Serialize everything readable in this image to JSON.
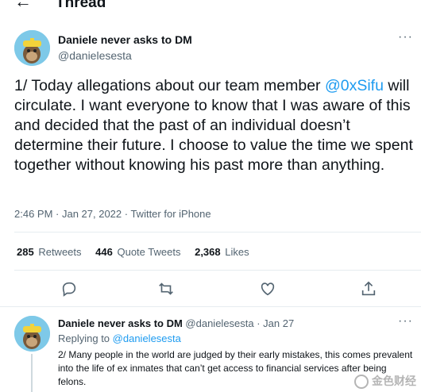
{
  "header": {
    "title": "Thread"
  },
  "tweet": {
    "author_name": "Daniele never asks to DM",
    "author_handle": "@danielesesta",
    "text_before": "1/ Today allegations about our team member ",
    "mention": "@0xSifu",
    "text_after": " will circulate. I want everyone to know that I was aware of this and decided that the past of an individual doesn’t determine their future. I choose to value the time we spent together without knowing his past more than anything.",
    "meta": "2:46 PM · Jan 27, 2022 · Twitter for iPhone",
    "stats": {
      "retweets_count": "285",
      "retweets_label": "Retweets",
      "quotes_count": "446",
      "quotes_label": "Quote Tweets",
      "likes_count": "2,368",
      "likes_label": "Likes"
    }
  },
  "reply": {
    "author_name": "Daniele never asks to DM",
    "handle_date": "@danielesesta · Jan 27",
    "replying_label": "Replying to",
    "replying_mention": "@danielesesta",
    "text": "2/ Many people in the world are judged by their early mistakes, this comes prevalent into the life of ex inmates that can’t get access to financial services after being felons."
  },
  "icons": {
    "back": "arrow-left-icon",
    "more": "more-dots-icon",
    "reply": "reply-icon",
    "retweet": "retweet-icon",
    "like": "heart-icon",
    "share": "share-icon"
  },
  "watermark": "金色财经",
  "colors": {
    "accent": "#1d9bf0",
    "text": "#0f1419",
    "muted": "#536471",
    "divider": "#e6ecf0"
  }
}
